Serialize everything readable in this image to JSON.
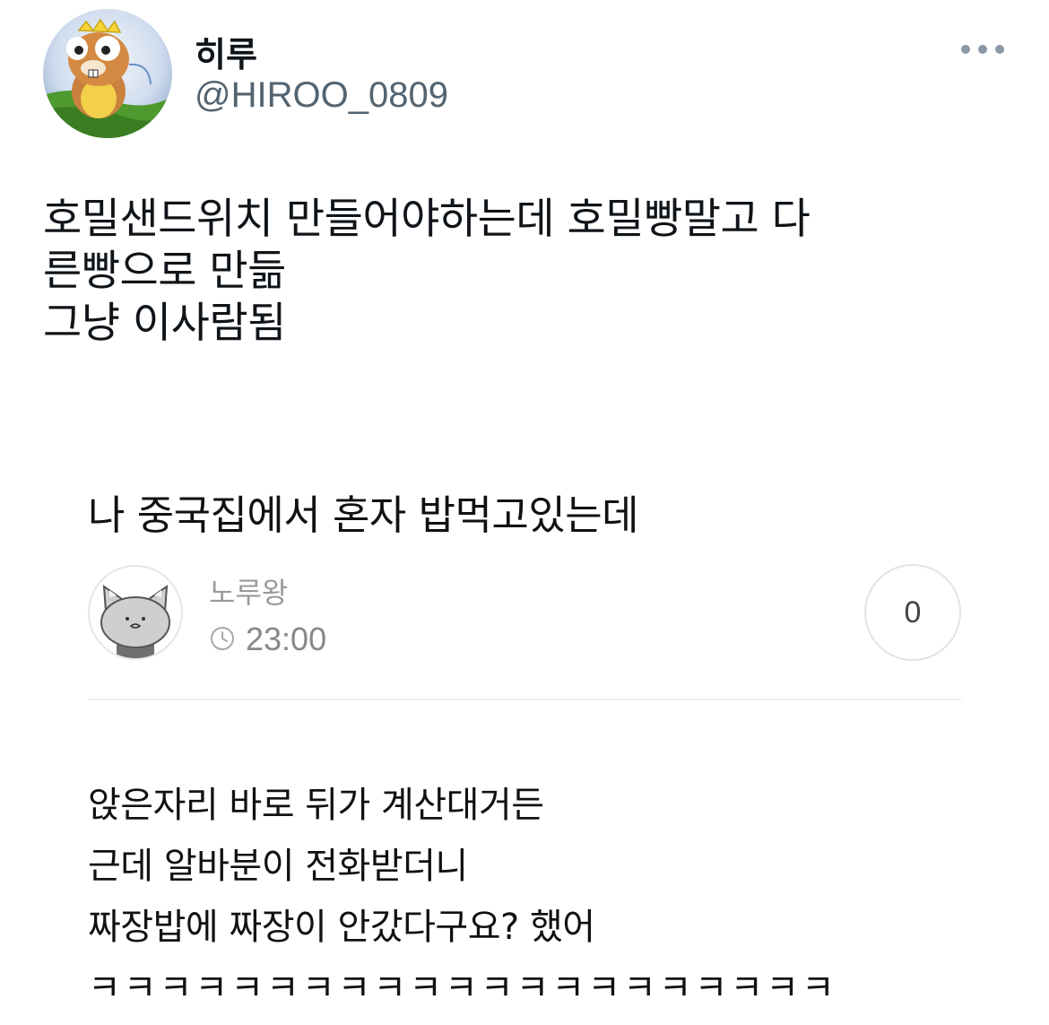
{
  "tweet": {
    "author": {
      "display_name": "히루",
      "handle": "@HIROO_0809",
      "avatar_icon": "cartoon-hamster-avatar"
    },
    "more_icon": "more-dots-icon",
    "text_lines": [
      "호밀샌드위치 만들어야하는데 호밀빵말고 다",
      "른빵으로 만듦",
      "그냥 이사람됨"
    ]
  },
  "embedded_post": {
    "title": "나 중국집에서 혼자 밥먹고있는데",
    "author_name": "노루왕",
    "author_avatar_icon": "gray-cat-avatar",
    "time_icon": "clock-icon",
    "time": "23:00",
    "comment_count": "0",
    "body_lines": [
      "앉은자리 바로 뒤가 계산대거든",
      "근데 알바분이 전화받더니",
      "짜장밥에 짜장이 안갔다구요? 했어",
      "ㅋㅋㅋㅋㅋㅋㅋㅋㅋㅋㅋㅋㅋㅋㅋㅋㅋㅋㅋㅋㅋ"
    ]
  },
  "colors": {
    "text": "#0f1419",
    "handle": "#536471",
    "muted": "#9a9a9a",
    "divider": "#ededed"
  }
}
